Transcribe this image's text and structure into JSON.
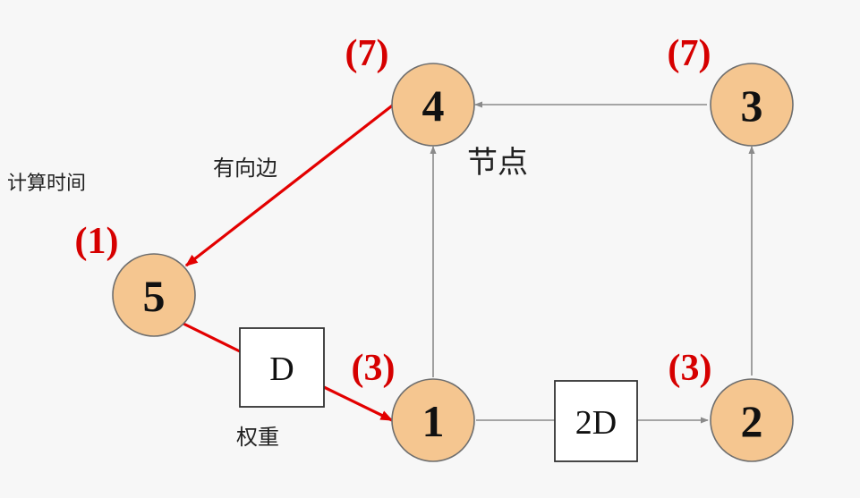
{
  "annotations": {
    "compute_time": "计算时间",
    "directed_edge": "有向边",
    "node": "节点",
    "weight": "权重"
  },
  "nodes": [
    {
      "id": "1",
      "time": "(3)"
    },
    {
      "id": "2",
      "time": "(3)"
    },
    {
      "id": "3",
      "time": "(7)"
    },
    {
      "id": "4",
      "time": "(7)"
    },
    {
      "id": "5",
      "time": "(1)"
    }
  ],
  "edge_weights": {
    "5_to_1": "D",
    "1_to_2": "2D"
  },
  "edges": [
    {
      "from": "1",
      "to": "2",
      "critical": false
    },
    {
      "from": "2",
      "to": "3",
      "critical": false
    },
    {
      "from": "3",
      "to": "4",
      "critical": false
    },
    {
      "from": "1",
      "to": "4",
      "critical": false
    },
    {
      "from": "4",
      "to": "5",
      "critical": true
    },
    {
      "from": "5",
      "to": "1",
      "critical": true
    }
  ],
  "colors": {
    "node_fill": "#f5c690",
    "node_stroke": "#6e6e6e",
    "critical_edge": "#e30000",
    "normal_edge": "#8a8a8a",
    "time_label": "#d60000"
  }
}
